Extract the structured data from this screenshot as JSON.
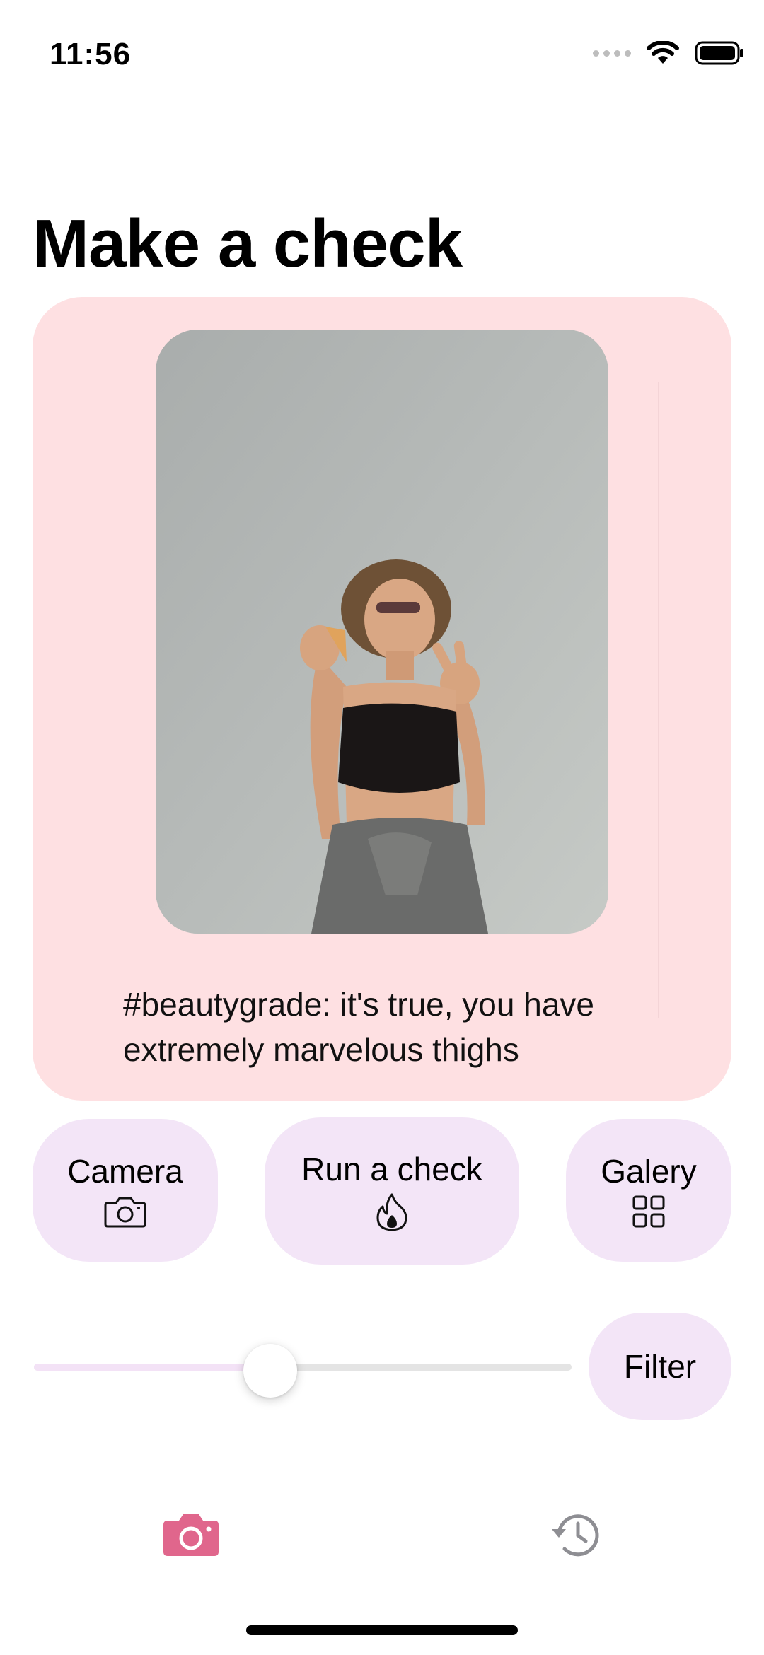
{
  "status_bar": {
    "time": "11:56",
    "icons": [
      "signal-icon",
      "wifi-icon",
      "battery-icon"
    ]
  },
  "page": {
    "title": "Make a check"
  },
  "result_card": {
    "background": "#fee0e2",
    "text": "#beautygrade: it's true, you have extremely marvelous thighs"
  },
  "actions": {
    "camera": {
      "label": "Camera",
      "icon": "camera-icon"
    },
    "run_check": {
      "label": "Run a check",
      "icon": "fire-icon"
    },
    "galery": {
      "label": "Galery",
      "icon": "grid-icon"
    }
  },
  "slider": {
    "value": 0.44
  },
  "filter": {
    "label": "Filter"
  },
  "tab_bar": {
    "active_color": "#e0668c",
    "inactive_color": "#8e8e93",
    "tabs": [
      {
        "icon": "camera-icon",
        "active": true
      },
      {
        "icon": "history-icon",
        "active": false
      }
    ]
  },
  "colors": {
    "accent_button": "#f3e5f7",
    "slider_fill": "#f3e2f6"
  }
}
